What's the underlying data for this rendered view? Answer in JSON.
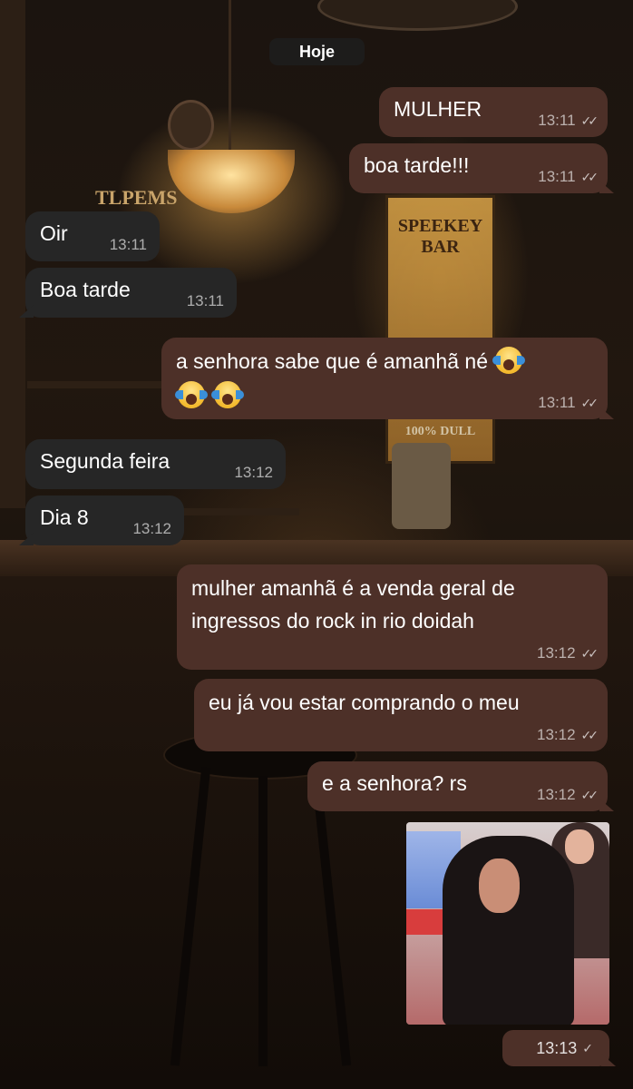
{
  "chat": {
    "date_label": "Hoje",
    "messages": [
      {
        "direction": "out",
        "text": "MULHER",
        "time": "13:11",
        "status": "read"
      },
      {
        "direction": "out",
        "text": "boa tarde!!!",
        "time": "13:11",
        "status": "read"
      },
      {
        "direction": "in",
        "text": "Oir",
        "time": "13:11"
      },
      {
        "direction": "in",
        "text": "Boa tarde",
        "time": "13:11"
      },
      {
        "direction": "out",
        "text_line1": "a senhora sabe que é amanhã né",
        "time": "13:11",
        "status": "read",
        "emojis": "😱😱😱"
      },
      {
        "direction": "in",
        "text": "Segunda feira",
        "time": "13:12"
      },
      {
        "direction": "in",
        "text": "Dia 8",
        "time": "13:12"
      },
      {
        "direction": "out",
        "text_line1": "mulher amanhã é a venda geral de",
        "text_line2": "ingressos do rock in rio doidah",
        "time": "13:12",
        "status": "read"
      },
      {
        "direction": "out",
        "text": "eu já vou estar comprando o meu",
        "time": "13:12",
        "status": "read"
      },
      {
        "direction": "out",
        "text": "e a senhora? rs",
        "time": "13:12",
        "status": "read"
      },
      {
        "direction": "out",
        "type": "image",
        "time": "13:13",
        "status": "sent"
      }
    ]
  },
  "background": {
    "poster_title": "SPEEKEY BAR",
    "poster_bottom": "100% DULL",
    "sign_text": "TLPEMS"
  },
  "colors": {
    "outgoing_bubble": "#4d3028",
    "incoming_bubble": "#262626",
    "date_pill": "#1e1e1e"
  }
}
